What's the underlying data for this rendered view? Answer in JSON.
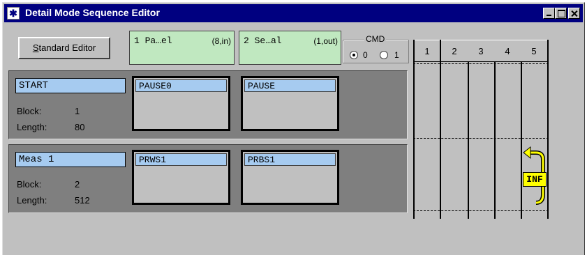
{
  "window": {
    "title": "Detail Mode Sequence Editor"
  },
  "toolbar": {
    "standard_editor_prefix": "S",
    "standard_editor_rest": "tandard Editor"
  },
  "sequences": [
    {
      "name": "1 Pa…el",
      "info": "(8,in)",
      "color": "#c0e8c0"
    },
    {
      "name": "2 Se…al",
      "info": "(1,out)",
      "color": "#c0e8c0"
    }
  ],
  "cmd": {
    "legend": "CMD",
    "options": [
      "0",
      "1"
    ],
    "selected": "0"
  },
  "blocks": [
    {
      "title": "START",
      "block_label": "Block:",
      "block_value": "1",
      "length_label": "Length:",
      "length_value": "80",
      "slots": [
        "PAUSE0",
        "PAUSE"
      ]
    },
    {
      "title": "Meas 1",
      "block_label": "Block:",
      "block_value": "2",
      "length_label": "Length:",
      "length_value": "512",
      "slots": [
        "PRWS1",
        "PRBS1"
      ]
    }
  ],
  "grid": {
    "columns": [
      "1",
      "2",
      "3",
      "4",
      "5"
    ]
  },
  "loop_marker": {
    "label": "INF",
    "color": "#ffff00"
  }
}
